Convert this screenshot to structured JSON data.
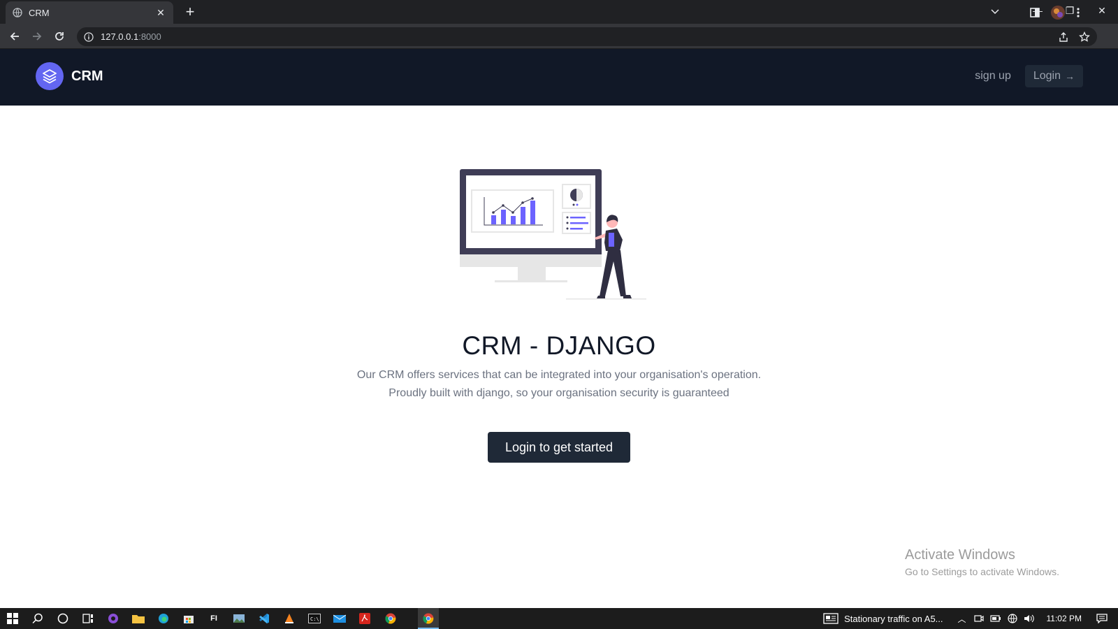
{
  "browser": {
    "tab_title": "CRM",
    "url_host": "127.0.0.1",
    "url_port": ":8000"
  },
  "site": {
    "brand": "CRM",
    "nav": {
      "signup": "sign up",
      "login": "Login"
    },
    "hero": {
      "title": "CRM - DJANGO",
      "description": "Our CRM offers services that can be integrated into your organisation's operation. Proudly built with django, so your organisation security is guaranteed",
      "cta": "Login to get started"
    },
    "colors": {
      "nav_bg": "#111827",
      "accent": "#6366f1",
      "cta_bg": "#1f2937"
    }
  },
  "watermark": {
    "line1": "Activate Windows",
    "line2": "Go to Settings to activate Windows."
  },
  "taskbar": {
    "news": "Stationary traffic on A5...",
    "time": "11:02 PM",
    "apps": [
      "windows-start-icon",
      "search-icon",
      "cortana-icon",
      "task-view-icon",
      "app-purple-icon",
      "file-explorer-icon",
      "edge-icon",
      "store-icon",
      "fi-app-icon",
      "image-app-icon",
      "vscode-icon",
      "vlc-icon",
      "terminal-icon",
      "mail-icon",
      "acrobat-icon",
      "chrome-icon",
      "chrome-active-icon"
    ]
  }
}
